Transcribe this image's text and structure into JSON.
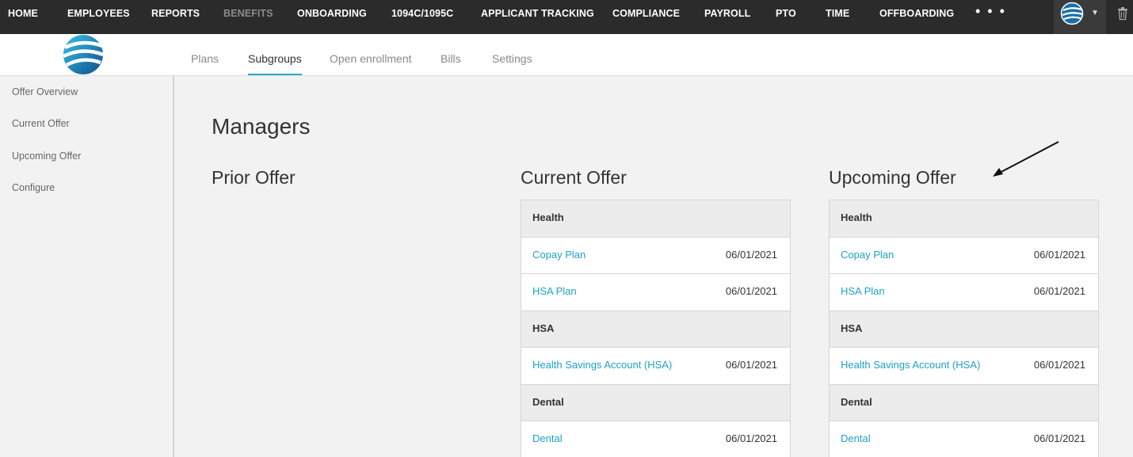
{
  "topnav": {
    "items": [
      "HOME",
      "EMPLOYEES",
      "REPORTS",
      "BENEFITS",
      "ONBOARDING",
      "1094C/1095C",
      "APPLICANT TRACKING",
      "COMPLIANCE",
      "PAYROLL",
      "PTO",
      "TIME",
      "OFFBOARDING"
    ],
    "active": "BENEFITS",
    "more_label": "• • •",
    "account_icon": "globe-avatar-icon",
    "caret_icon": "chevron-down-icon",
    "trash_icon": "trash-icon"
  },
  "tabs": {
    "items": [
      "Plans",
      "Subgroups",
      "Open enrollment",
      "Bills",
      "Settings"
    ],
    "active": "Subgroups"
  },
  "sidebar": {
    "items": [
      "Offer Overview",
      "Current Offer",
      "Upcoming Offer",
      "Configure"
    ]
  },
  "main": {
    "title": "Managers",
    "columns": [
      {
        "title": "Prior Offer"
      },
      {
        "title": "Current Offer",
        "rows": [
          {
            "type": "section",
            "label": "Health"
          },
          {
            "type": "plan",
            "label": "Copay Plan",
            "date": "06/01/2021"
          },
          {
            "type": "plan",
            "label": "HSA Plan",
            "date": "06/01/2021"
          },
          {
            "type": "section",
            "label": "HSA"
          },
          {
            "type": "plan",
            "label": "Health Savings Account (HSA)",
            "date": "06/01/2021"
          },
          {
            "type": "section",
            "label": "Dental"
          },
          {
            "type": "plan",
            "label": "Dental",
            "date": "06/01/2021"
          }
        ]
      },
      {
        "title": "Upcoming Offer",
        "rows": [
          {
            "type": "section",
            "label": "Health"
          },
          {
            "type": "plan",
            "label": "Copay Plan",
            "date": "06/01/2021"
          },
          {
            "type": "plan",
            "label": "HSA Plan",
            "date": "06/01/2021"
          },
          {
            "type": "section",
            "label": "HSA"
          },
          {
            "type": "plan",
            "label": "Health Savings Account (HSA)",
            "date": "06/01/2021"
          },
          {
            "type": "section",
            "label": "Dental"
          },
          {
            "type": "plan",
            "label": "Dental",
            "date": "06/01/2021"
          }
        ]
      }
    ]
  },
  "colors": {
    "nav_bg": "#2b2b2b",
    "link": "#1ea1c7",
    "tab_underline": "#29a9c9",
    "section_bg": "#ececec"
  }
}
